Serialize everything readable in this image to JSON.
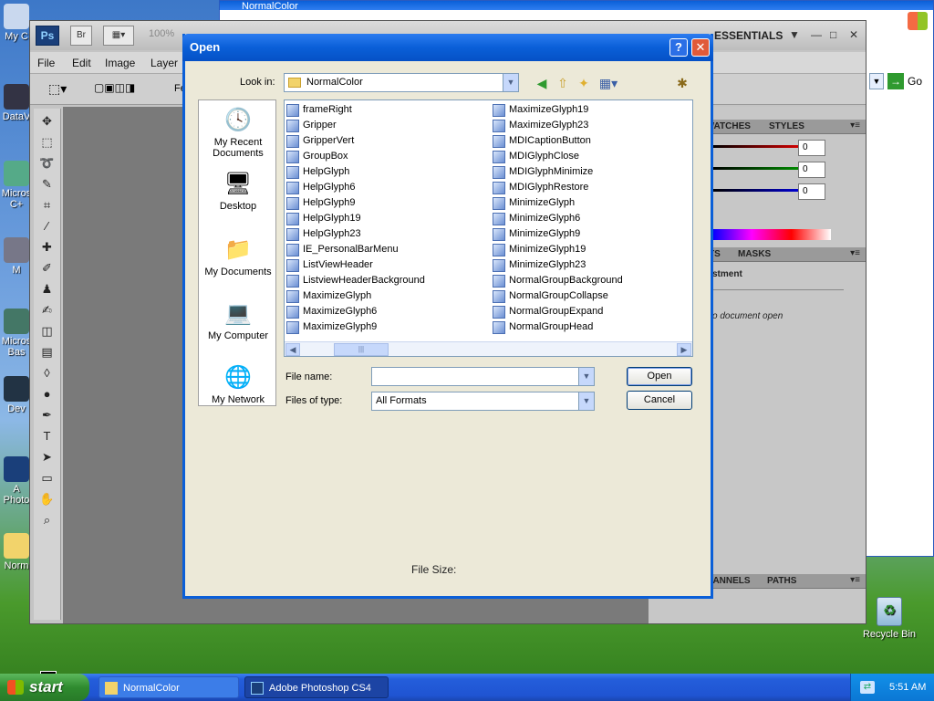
{
  "desktop": {
    "icons": [
      {
        "label": "My C"
      },
      {
        "label": "DataV"
      },
      {
        "label": "Micros C+"
      },
      {
        "label": "M"
      },
      {
        "label": "Micros Bas"
      },
      {
        "label": "Dev"
      },
      {
        "label": "A Photo"
      },
      {
        "label": "Norm"
      }
    ],
    "recycle_bin": "Recycle Bin"
  },
  "ie_window": {
    "title": "NormalColor",
    "go_label": "Go"
  },
  "photoshop": {
    "logo": "Ps",
    "bridge": "Br",
    "zoom": "100%",
    "workspace": "ESSENTIALS",
    "menu": [
      "File",
      "Edit",
      "Image",
      "Layer"
    ],
    "options_clip": "Fe",
    "panels": {
      "swatches_tab": "SWATCHES",
      "styles_tab": "STYLES",
      "slider_values": [
        "0",
        "0",
        "0"
      ],
      "adjust_tab": "TS",
      "masks_tab": "MASKS",
      "adjust_heading": "stment",
      "adjust_text": "o document open",
      "channels_tab": "CHANNELS",
      "paths_tab": "PATHS"
    }
  },
  "dialog": {
    "title": "Open",
    "help": "?",
    "close": "✕",
    "look_in_label": "Look in:",
    "look_in_value": "NormalColor",
    "places": [
      {
        "label": "My Recent Documents",
        "icon": "recent-documents-icon"
      },
      {
        "label": "Desktop",
        "icon": "desktop-icon"
      },
      {
        "label": "My Documents",
        "icon": "my-documents-icon"
      },
      {
        "label": "My Computer",
        "icon": "my-computer-icon"
      },
      {
        "label": "My Network",
        "icon": "my-network-icon"
      }
    ],
    "files_col1": [
      "frameRight",
      "Gripper",
      "GripperVert",
      "GroupBox",
      "HelpGlyph",
      "HelpGlyph6",
      "HelpGlyph9",
      "HelpGlyph19",
      "HelpGlyph23",
      "IE_PersonalBarMenu",
      "ListViewHeader",
      "ListviewHeaderBackground",
      "MaximizeGlyph",
      "MaximizeGlyph6",
      "MaximizeGlyph9"
    ],
    "files_col2": [
      "MaximizeGlyph19",
      "MaximizeGlyph23",
      "MDICaptionButton",
      "MDIGlyphClose",
      "MDIGlyphMinimize",
      "MDIGlyphRestore",
      "MinimizeGlyph",
      "MinimizeGlyph6",
      "MinimizeGlyph9",
      "MinimizeGlyph19",
      "MinimizeGlyph23",
      "NormalGroupBackground",
      "NormalGroupCollapse",
      "NormalGroupExpand",
      "NormalGroupHead"
    ],
    "file_name_label": "File name:",
    "file_name_value": "",
    "files_of_type_label": "Files of type:",
    "files_of_type_value": "All Formats",
    "open_button": "Open",
    "cancel_button": "Cancel",
    "file_size_label": "File Size:"
  },
  "taskbar": {
    "start": "start",
    "tasks": [
      {
        "label": "NormalColor"
      },
      {
        "label": "Adobe Photoshop CS4"
      }
    ],
    "clock": "5:51 AM"
  },
  "colors": {
    "xp_blue": "#0a5fd8",
    "start_green": "#2f8b2f",
    "ps_canvas": "#7a7a7a"
  }
}
